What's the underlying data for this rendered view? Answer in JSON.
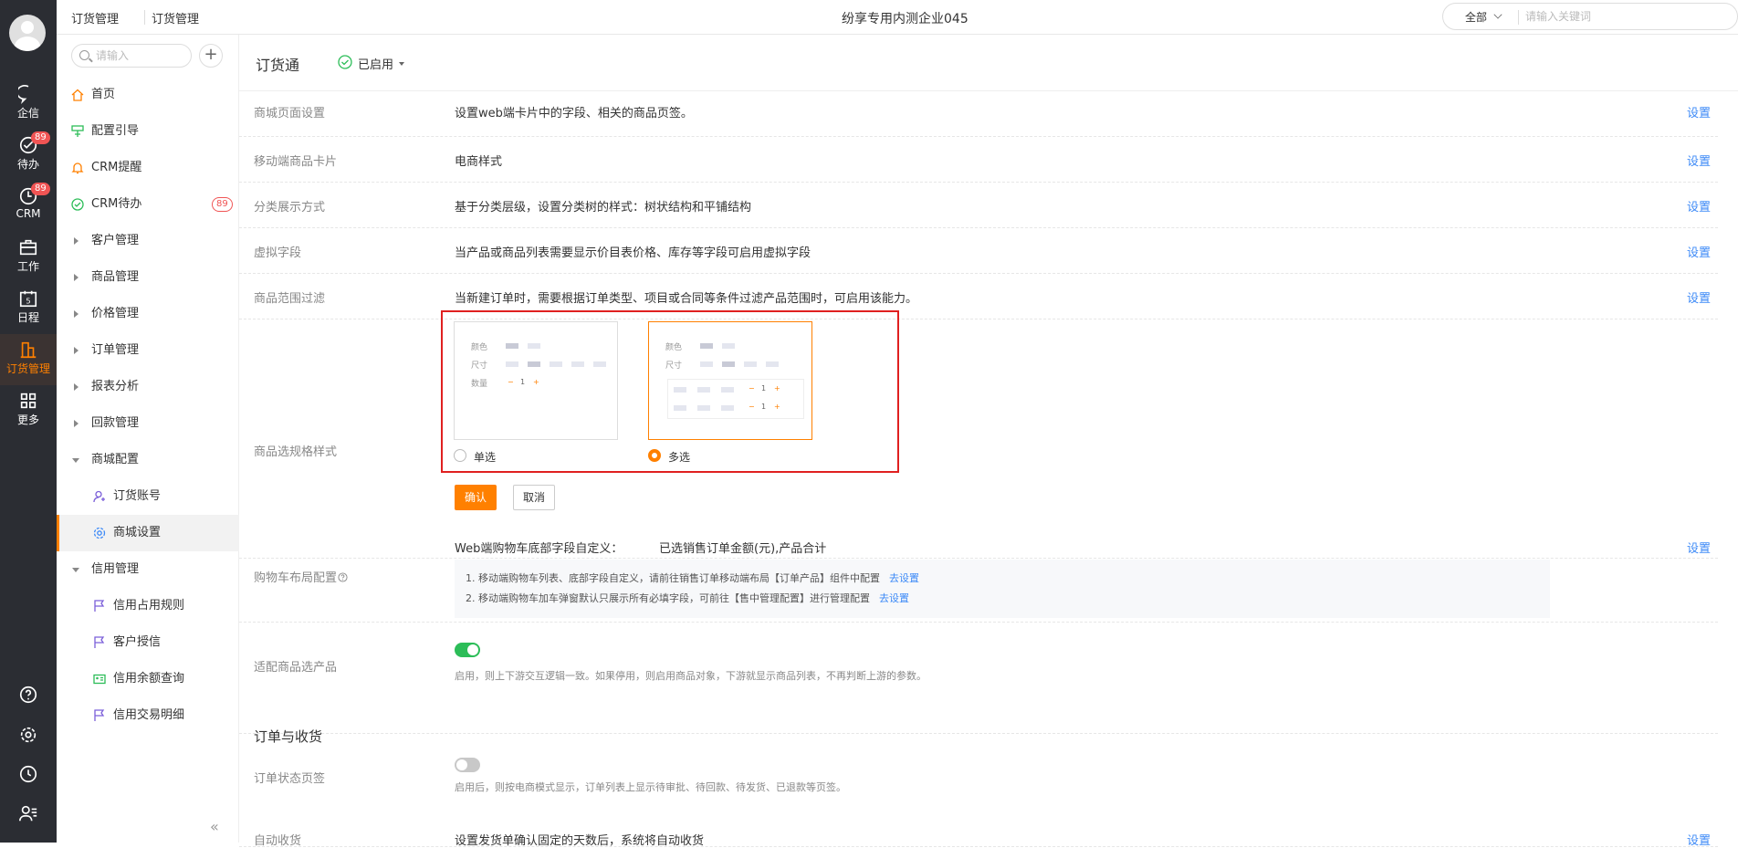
{
  "rail": {
    "items": [
      {
        "label": "企信",
        "icon": "chat-icon"
      },
      {
        "label": "待办",
        "icon": "check-circle-icon",
        "badge": "89"
      },
      {
        "label": "CRM",
        "icon": "clock-icon",
        "badge": "89"
      },
      {
        "label": "工作",
        "icon": "briefcase-icon"
      },
      {
        "label": "日程",
        "icon": "calendar-icon",
        "day": "5"
      },
      {
        "label": "订货管理",
        "icon": "building-icon"
      },
      {
        "label": "更多",
        "icon": "grid-icon"
      }
    ],
    "bottom_icons": [
      "help-icon",
      "settings-icon",
      "history-icon",
      "user-manage-icon"
    ]
  },
  "header": {
    "breadcrumb_1": "订货管理",
    "breadcrumb_2": "订货管理",
    "company": "纷享专用内测企业045",
    "search_scope": "全部",
    "search_placeholder": "请输入关键词"
  },
  "sidebar": {
    "search_placeholder": "请输入",
    "add_symbol": "+",
    "items": [
      {
        "label": "首页"
      },
      {
        "label": "配置引导"
      },
      {
        "label": "CRM提醒"
      },
      {
        "label": "CRM待办",
        "badge": "89"
      },
      {
        "label": "客户管理"
      },
      {
        "label": "商品管理"
      },
      {
        "label": "价格管理"
      },
      {
        "label": "订单管理"
      },
      {
        "label": "报表分析"
      },
      {
        "label": "回款管理"
      },
      {
        "label": "商城配置"
      },
      {
        "label": "订货账号"
      },
      {
        "label": "商城设置"
      },
      {
        "label": "信用管理"
      },
      {
        "label": "信用占用规则"
      },
      {
        "label": "客户授信"
      },
      {
        "label": "信用余额查询"
      },
      {
        "label": "信用交易明细"
      }
    ],
    "collapse_symbol": "«"
  },
  "main": {
    "title": "订货通",
    "status": "已启用",
    "settings_link": "设置",
    "rows": [
      {
        "label": "商城页面设置",
        "desc": "设置web端卡片中的字段、相关的商品页签。"
      },
      {
        "label": "移动端商品卡片",
        "desc": "电商样式"
      },
      {
        "label": "分类展示方式",
        "desc": "基于分类层级，设置分类树的样式：树状结构和平铺结构"
      },
      {
        "label": "虚拟字段",
        "desc": "当产品或商品列表需要显示价目表价格、库存等字段可启用虚拟字段"
      },
      {
        "label": "商品范围过滤",
        "desc": "当新建订单时，需要根据订单类型、项目或合同等条件过滤产品范围时，可启用该能力。"
      }
    ],
    "spec_style": {
      "label": "商品选规格样式",
      "card_keys": {
        "color": "颜色",
        "size": "尺寸",
        "qty": "数量"
      },
      "stepper": {
        "minus": "−",
        "value": "1",
        "plus": "+"
      },
      "options": [
        {
          "label": "单选",
          "selected": false
        },
        {
          "label": "多选",
          "selected": true
        }
      ],
      "confirm": "确认",
      "cancel": "取消"
    },
    "cart": {
      "label": "购物车布局配置",
      "help_icon": "question-icon",
      "field_title": "Web端购物车底部字段自定义：",
      "field_value": "已选销售订单金额(元),产品合计",
      "notes": [
        {
          "text": "1. 移动端购物车列表、底部字段自定义，请前往销售订单移动端布局【订单产品】组件中配置",
          "link": "去设置"
        },
        {
          "text": "2. 移动端购物车加车弹窗默认只展示所有必填字段，可前往【售中管理配置】进行管理配置",
          "link": "去设置"
        }
      ]
    },
    "adapt": {
      "label": "适配商品选产品",
      "enabled": true,
      "hint": "启用，则上下游交互逻辑一致。如果停用，则启用商品对象，下游就显示商品列表，不再判断上游的参数。"
    },
    "order_section": "订单与收货",
    "order_status": {
      "label": "订单状态页签",
      "enabled": false,
      "hint": "启用后，则按电商模式显示，订单列表上显示待审批、待回款、待发货、已退款等页签。"
    },
    "auto_receive": {
      "label": "自动收货",
      "desc": "设置发货单确认固定的天数后，系统将自动收货"
    }
  }
}
